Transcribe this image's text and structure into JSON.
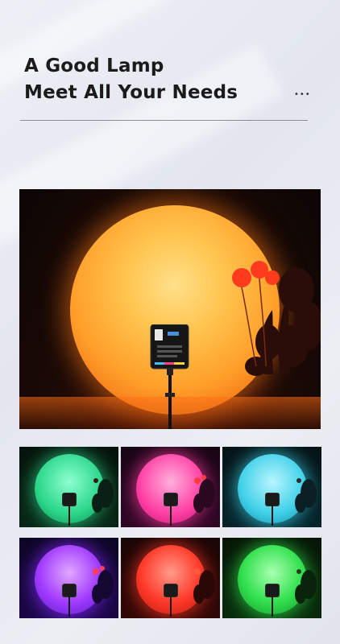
{
  "heading": {
    "line1": "A Good Lamp",
    "line2": "Meet All Your Needs"
  },
  "colors": {
    "sunset": "#ff9f2a",
    "background": "#e6e8f0",
    "text": "#1b1b1b"
  },
  "thumbnails": [
    {
      "color": "#2bd68a",
      "bg": "#08130c"
    },
    {
      "color": "#ff3fa3",
      "bg": "#1a0616"
    },
    {
      "color": "#3fd0e8",
      "bg": "#061417"
    },
    {
      "color": "#8a2cff",
      "bg": "#0d0620"
    },
    {
      "color": "#ff3a2a",
      "bg": "#1a0605"
    },
    {
      "color": "#32e04e",
      "bg": "#061a08"
    }
  ]
}
